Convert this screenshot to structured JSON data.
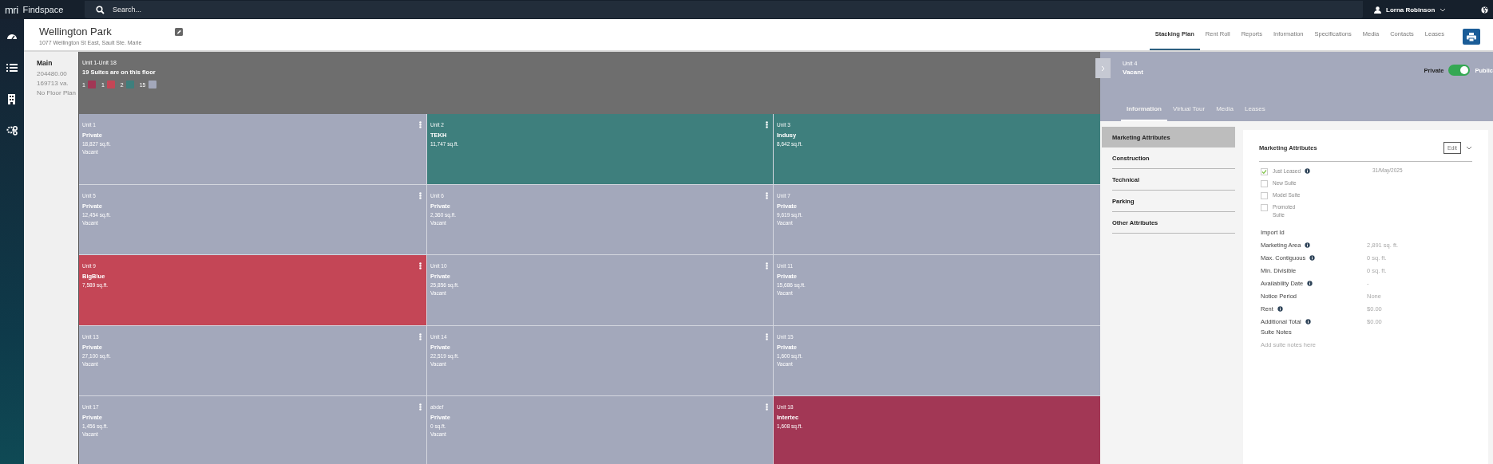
{
  "topbar": {
    "brand": "mri",
    "product": "Findspace",
    "search": {
      "placeholder": "Search..."
    },
    "user": "Lorna Robinson"
  },
  "property": {
    "name": "Wellington Park",
    "address": "1077 Wellington St East, Sault Ste. Marie"
  },
  "nav_tabs": [
    {
      "label": "Stacking Plan",
      "selected": true
    },
    {
      "label": "Rent Roll",
      "selected": false
    },
    {
      "label": "Reports",
      "selected": false
    },
    {
      "label": "Information",
      "selected": false
    },
    {
      "label": "Specifications",
      "selected": false
    },
    {
      "label": "Media",
      "selected": false
    },
    {
      "label": "Contacts",
      "selected": false
    },
    {
      "label": "Leases",
      "selected": false
    }
  ],
  "floors": [
    {
      "name": "Main",
      "lines": [
        "204480.00",
        "169713 va.",
        "No Floor Plan"
      ]
    }
  ],
  "stack": {
    "range": "Unit 1-Unit 18",
    "summary": "19 Suites are on this floor",
    "legend": [
      {
        "count": "1",
        "color": "#a23755"
      },
      {
        "count": "1",
        "color": "#c44656"
      },
      {
        "count": "2",
        "color": "#3e7f7d"
      },
      {
        "count": "15",
        "color": "#a3a8bb"
      }
    ],
    "units": [
      {
        "unit": "Unit 1",
        "tenant": "Private",
        "area": "18,827 sq.ft.",
        "status": "Vacant",
        "color": "#a3a8bb",
        "menu": true
      },
      {
        "unit": "Unit 2",
        "tenant": "TEKH",
        "area": "11,747 sq.ft.",
        "color": "#3e7f7d",
        "menu": true
      },
      {
        "unit": "Unit 3",
        "tenant": "Indusy",
        "area": "8,642 sq.ft.",
        "color": "#3e7f7d",
        "menu": false
      },
      {
        "unit": "Unit 5",
        "tenant": "Private",
        "area": "12,454 sq.ft.",
        "status": "Vacant",
        "color": "#a3a8bb",
        "menu": true
      },
      {
        "unit": "Unit 6",
        "tenant": "Private",
        "area": "2,360 sq.ft.",
        "status": "Vacant",
        "color": "#a3a8bb",
        "menu": true
      },
      {
        "unit": "Unit 7",
        "tenant": "Private",
        "area": "9,619 sq.ft.",
        "status": "Vacant",
        "color": "#a3a8bb",
        "menu": false
      },
      {
        "unit": "Unit 9",
        "tenant": "BigBlue",
        "area": "7,589 sq.ft.",
        "color": "#c44656",
        "menu": true
      },
      {
        "unit": "Unit 10",
        "tenant": "Private",
        "area": "25,856 sq.ft.",
        "status": "Vacant",
        "color": "#a3a8bb",
        "menu": true
      },
      {
        "unit": "Unit 11",
        "tenant": "Private",
        "area": "15,686 sq.ft.",
        "status": "Vacant",
        "color": "#a3a8bb",
        "menu": false
      },
      {
        "unit": "Unit 13",
        "tenant": "Private",
        "area": "27,100 sq.ft.",
        "status": "Vacant",
        "color": "#a3a8bb",
        "menu": true
      },
      {
        "unit": "Unit 14",
        "tenant": "Private",
        "area": "22,519 sq.ft.",
        "status": "Vacant",
        "color": "#a3a8bb",
        "menu": true
      },
      {
        "unit": "Unit 15",
        "tenant": "Private",
        "area": "1,600 sq.ft.",
        "status": "Vacant",
        "color": "#a3a8bb",
        "menu": false
      },
      {
        "unit": "Unit 17",
        "tenant": "Private",
        "area": "1,456 sq.ft.",
        "status": "Vacant",
        "color": "#a3a8bb",
        "menu": true
      },
      {
        "unit": "abdef",
        "tenant": "Private",
        "area": "0 sq.ft.",
        "status": "Vacant",
        "color": "#a3a8bb",
        "menu": true
      },
      {
        "unit": "Unit 18",
        "tenant": "Intertec",
        "area": "1,608 sq.ft.",
        "color": "#a23755",
        "menu": false
      }
    ]
  },
  "detail": {
    "unit": "Unit 4",
    "status": "Vacant",
    "visibility": {
      "off_label": "Private",
      "on_label": "Public",
      "on": true
    },
    "tabs": [
      {
        "label": "Information",
        "selected": true
      },
      {
        "label": "Virtual Tour",
        "selected": false
      },
      {
        "label": "Media",
        "selected": false
      },
      {
        "label": "Leases",
        "selected": false
      }
    ],
    "sections": [
      {
        "label": "Marketing Attributes",
        "selected": true
      },
      {
        "label": "Construction",
        "selected": false
      },
      {
        "label": "Technical",
        "selected": false
      },
      {
        "label": "Parking",
        "selected": false
      },
      {
        "label": "Other Attributes",
        "selected": false
      }
    ],
    "card": {
      "title": "Marketing Attributes",
      "edit": "Edit",
      "flags": [
        {
          "label": "Just Leased",
          "checked": true,
          "info": true,
          "date": "31/May/2025"
        },
        {
          "label": "New Suite",
          "checked": false,
          "info": false
        },
        {
          "label": "Model Suite",
          "checked": false,
          "info": false
        },
        {
          "label": "Promoted Suite",
          "checked": false,
          "info": false
        }
      ],
      "attributes": [
        {
          "label": "Import Id",
          "info": false
        },
        {
          "label": "Marketing Area",
          "info": true,
          "value": "2,891 sq. ft."
        },
        {
          "label": "Max. Contiguous",
          "info": true,
          "value": "0 sq. ft."
        },
        {
          "label": "Min. Divisible",
          "info": false,
          "value": "0 sq. ft."
        },
        {
          "label": "Availability Date",
          "info": true,
          "value": "-"
        },
        {
          "label": "Notice Period",
          "info": false,
          "value": "None"
        },
        {
          "label": "Rent",
          "info": true,
          "value": "$0.00"
        },
        {
          "label": "Additional Total",
          "info": true,
          "value": "$0.00"
        }
      ],
      "notes": {
        "label": "Suite Notes",
        "placeholder": "Add suite notes here"
      }
    }
  }
}
